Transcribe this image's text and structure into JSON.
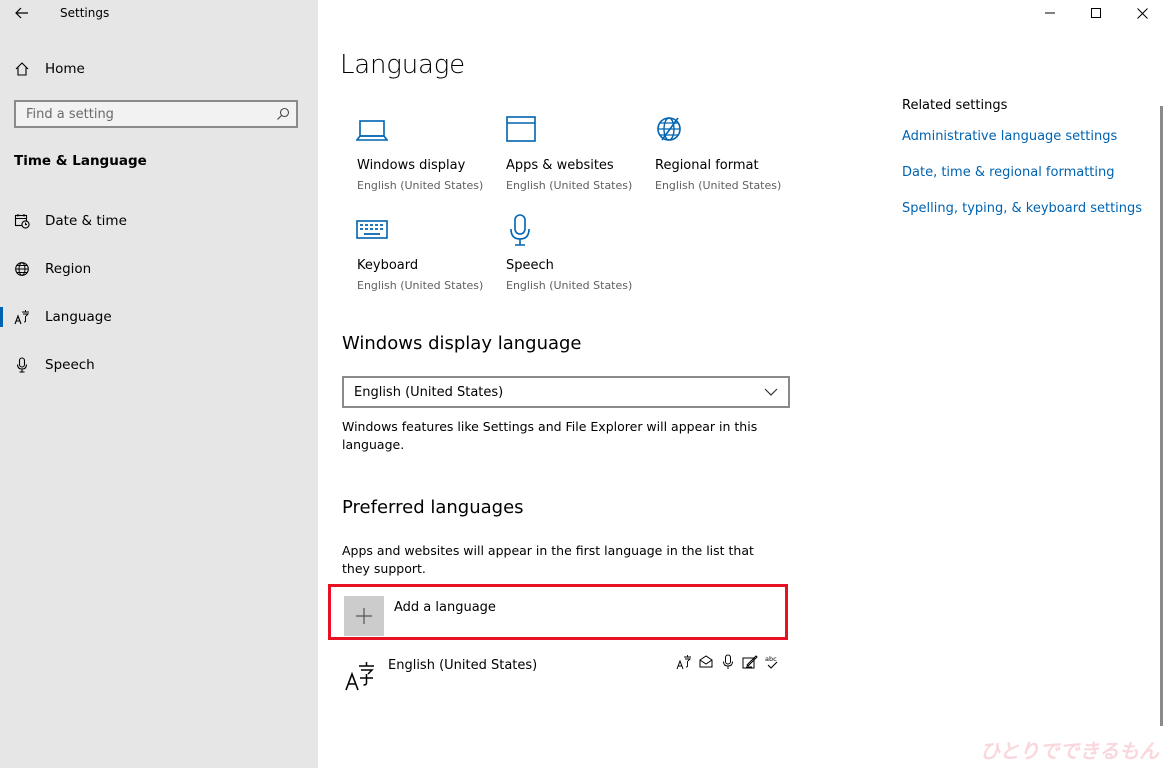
{
  "app": {
    "title": "Settings"
  },
  "window_controls": {
    "minimize": "minimize-icon",
    "maximize": "maximize-icon",
    "close": "close-icon"
  },
  "sidebar": {
    "home_label": "Home",
    "search_placeholder": "Find a setting",
    "section_title": "Time & Language",
    "items": [
      {
        "label": "Date & time",
        "icon": "calendar-clock-icon",
        "active": false
      },
      {
        "label": "Region",
        "icon": "globe-icon",
        "active": false
      },
      {
        "label": "Language",
        "icon": "language-icon",
        "active": true
      },
      {
        "label": "Speech",
        "icon": "microphone-icon",
        "active": false
      }
    ]
  },
  "main": {
    "title": "Language",
    "tiles": [
      {
        "name": "Windows display",
        "sub": "English (United States)",
        "icon": "laptop-icon"
      },
      {
        "name": "Apps & websites",
        "sub": "English (United States)",
        "icon": "window-icon"
      },
      {
        "name": "Regional format",
        "sub": "English (United States)",
        "icon": "globe-icon"
      },
      {
        "name": "Keyboard",
        "sub": "English (United States)",
        "icon": "keyboard-icon"
      },
      {
        "name": "Speech",
        "sub": "English (United States)",
        "icon": "microphone-icon"
      }
    ],
    "display_language": {
      "heading": "Windows display language",
      "selected": "English (United States)",
      "description": "Windows features like Settings and File Explorer will appear in this language."
    },
    "preferred": {
      "heading": "Preferred languages",
      "description": "Apps and websites will appear in the first language in the list that they support.",
      "add_label": "Add a language",
      "languages": [
        {
          "name": "English (United States)",
          "features": [
            "display-language-icon",
            "text-to-speech-icon",
            "speech-recognition-icon",
            "handwriting-icon",
            "spellcheck-icon"
          ]
        }
      ]
    }
  },
  "related": {
    "title": "Related settings",
    "links": [
      "Administrative language settings",
      "Date, time & regional formatting",
      "Spelling, typing, & keyboard settings"
    ]
  },
  "colors": {
    "accent": "#0063b1",
    "highlight": "#e81123",
    "sidebar_bg": "#e6e6e6"
  }
}
